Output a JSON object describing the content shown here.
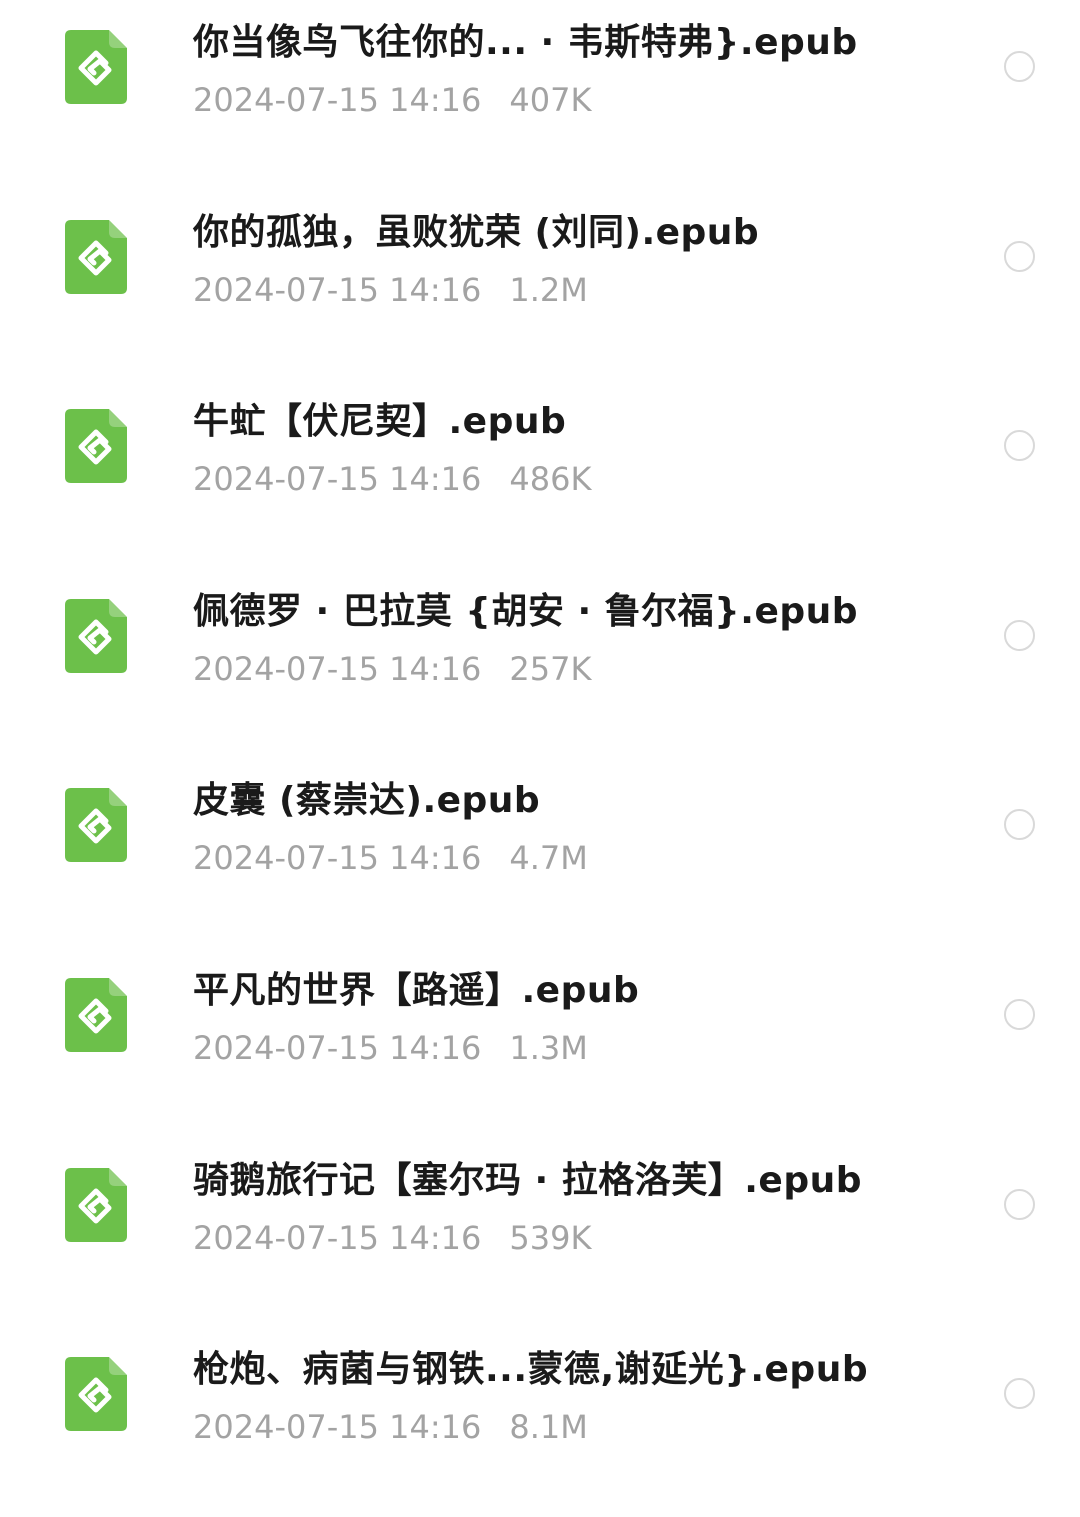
{
  "icon_color": "#6cc04a",
  "icon_name": "epub-file-icon",
  "files": [
    {
      "name": "你当像鸟飞往你的... · 韦斯特弗}.epub",
      "date": "2024-07-15 14:16",
      "size": "407K"
    },
    {
      "name": "你的孤独，虽败犹荣 (刘同).epub",
      "date": "2024-07-15 14:16",
      "size": "1.2M"
    },
    {
      "name": "牛虻【伏尼契】.epub",
      "date": "2024-07-15 14:16",
      "size": "486K"
    },
    {
      "name": "佩德罗 · 巴拉莫 {胡安 · 鲁尔福}.epub",
      "date": "2024-07-15 14:16",
      "size": "257K"
    },
    {
      "name": "皮囊 (蔡崇达).epub",
      "date": "2024-07-15 14:16",
      "size": "4.7M"
    },
    {
      "name": "平凡的世界【路遥】.epub",
      "date": "2024-07-15 14:16",
      "size": "1.3M"
    },
    {
      "name": "骑鹅旅行记【塞尔玛 · 拉格洛芙】.epub",
      "date": "2024-07-15 14:16",
      "size": "539K"
    },
    {
      "name": "枪炮、病菌与钢铁...蒙德,谢延光}.epub",
      "date": "2024-07-15 14:16",
      "size": "8.1M"
    }
  ]
}
